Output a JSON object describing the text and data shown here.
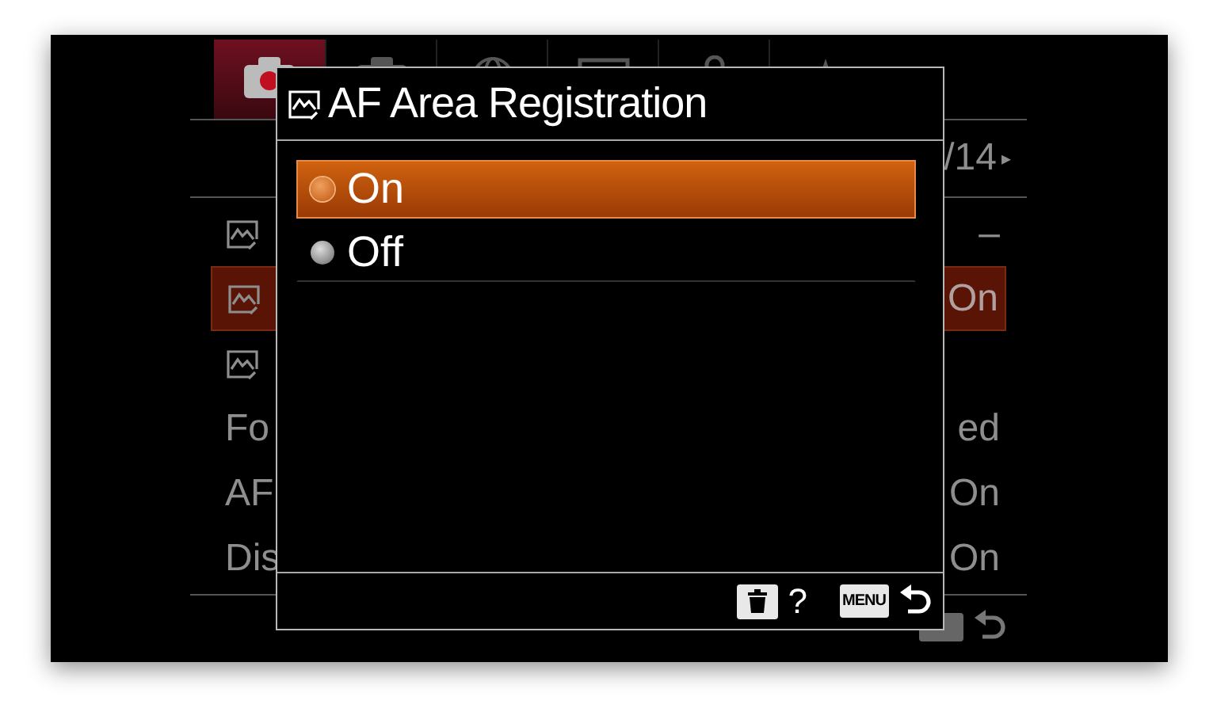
{
  "background_menu": {
    "tabs": [
      {
        "kind": "camera",
        "selected": true
      },
      {
        "kind": "camera",
        "selected": false
      },
      {
        "kind": "globe",
        "selected": false
      },
      {
        "kind": "monitor",
        "selected": false
      },
      {
        "kind": "bag",
        "selected": false
      },
      {
        "kind": "tool",
        "selected": false
      }
    ],
    "page_indicator": {
      "text": "/14",
      "arrow": "▸"
    },
    "rows": [
      {
        "kind": "icon",
        "value": "–",
        "selected": false
      },
      {
        "kind": "icon",
        "value": "On",
        "selected": true
      },
      {
        "kind": "icon",
        "selected": false
      },
      {
        "kind": "text",
        "label": "Fo",
        "value": "ed",
        "selected": false
      },
      {
        "kind": "text",
        "label": "AF",
        "value": "On",
        "selected": false
      },
      {
        "kind": "text",
        "label": "Dis",
        "value": "On",
        "selected": false
      }
    ]
  },
  "dialog": {
    "title": "AF Area Registration",
    "options": [
      {
        "label": "On",
        "selected": true
      },
      {
        "label": "Off",
        "selected": false
      }
    ],
    "footer": {
      "help": "?",
      "menu_key": "MENU"
    }
  }
}
